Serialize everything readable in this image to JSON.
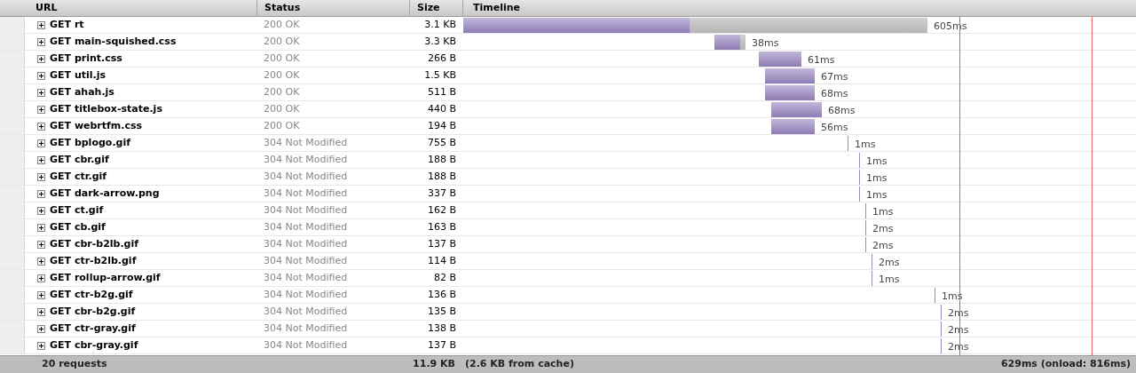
{
  "table": {
    "columns": [
      {
        "label": "URL"
      },
      {
        "label": "Status"
      },
      {
        "label": "Size"
      },
      {
        "label": "Timeline"
      }
    ],
    "rows": [
      {
        "request": "GET rt",
        "status": "200 OK",
        "size": "3.1 KB",
        "time": "605ms",
        "kind": "fetched"
      },
      {
        "request": "GET main-squished.css",
        "status": "200 OK",
        "size": "3.3 KB",
        "time": "38ms",
        "kind": "fetched"
      },
      {
        "request": "GET print.css",
        "status": "200 OK",
        "size": "266 B",
        "time": "61ms",
        "kind": "fetched"
      },
      {
        "request": "GET util.js",
        "status": "200 OK",
        "size": "1.5 KB",
        "time": "67ms",
        "kind": "fetched"
      },
      {
        "request": "GET ahah.js",
        "status": "200 OK",
        "size": "511 B",
        "time": "68ms",
        "kind": "fetched"
      },
      {
        "request": "GET titlebox-state.js",
        "status": "200 OK",
        "size": "440 B",
        "time": "68ms",
        "kind": "fetched"
      },
      {
        "request": "GET webrtfm.css",
        "status": "200 OK",
        "size": "194 B",
        "time": "56ms",
        "kind": "fetched"
      },
      {
        "request": "GET bplogo.gif",
        "status": "304 Not Modified",
        "size": "755 B",
        "time": "1ms",
        "kind": "cached"
      },
      {
        "request": "GET cbr.gif",
        "status": "304 Not Modified",
        "size": "188 B",
        "time": "1ms",
        "kind": "cached"
      },
      {
        "request": "GET ctr.gif",
        "status": "304 Not Modified",
        "size": "188 B",
        "time": "1ms",
        "kind": "cached"
      },
      {
        "request": "GET dark-arrow.png",
        "status": "304 Not Modified",
        "size": "337 B",
        "time": "1ms",
        "kind": "cached"
      },
      {
        "request": "GET ct.gif",
        "status": "304 Not Modified",
        "size": "162 B",
        "time": "1ms",
        "kind": "cached"
      },
      {
        "request": "GET cb.gif",
        "status": "304 Not Modified",
        "size": "163 B",
        "time": "2ms",
        "kind": "cached"
      },
      {
        "request": "GET cbr-b2lb.gif",
        "status": "304 Not Modified",
        "size": "137 B",
        "time": "2ms",
        "kind": "cached"
      },
      {
        "request": "GET ctr-b2lb.gif",
        "status": "304 Not Modified",
        "size": "114 B",
        "time": "2ms",
        "kind": "cached"
      },
      {
        "request": "GET rollup-arrow.gif",
        "status": "304 Not Modified",
        "size": "82 B",
        "time": "1ms",
        "kind": "cached"
      },
      {
        "request": "GET ctr-b2g.gif",
        "status": "304 Not Modified",
        "size": "136 B",
        "time": "1ms",
        "kind": "cached"
      },
      {
        "request": "GET cbr-b2g.gif",
        "status": "304 Not Modified",
        "size": "135 B",
        "time": "2ms",
        "kind": "cached"
      },
      {
        "request": "GET ctr-gray.gif",
        "status": "304 Not Modified",
        "size": "138 B",
        "time": "2ms",
        "kind": "cached"
      },
      {
        "request": "GET cbr-gray.gif",
        "status": "304 Not Modified",
        "size": "137 B",
        "time": "2ms",
        "kind": "cached"
      }
    ]
  },
  "status_bar": {
    "requests": "20 requests",
    "size": "11.9 KB",
    "cache": "(2.6 KB from cache)",
    "total": "629ms (onload: 816ms)"
  }
}
